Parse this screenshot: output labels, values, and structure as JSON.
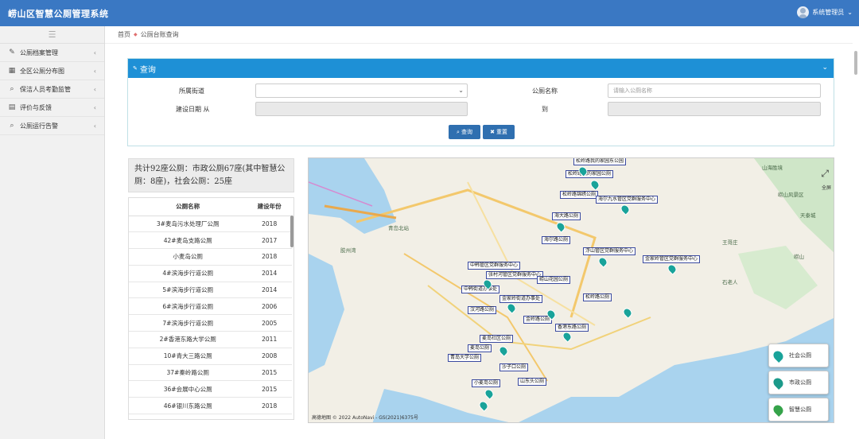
{
  "app": {
    "title": "崂山区智慧公厕管理系统",
    "user": "系统管理员"
  },
  "sidebar": {
    "items": [
      {
        "label": "公厕档案管理",
        "icon": "pencil-icon"
      },
      {
        "label": "全区公厕分布图",
        "icon": "map-icon"
      },
      {
        "label": "保洁人员考勤监管",
        "icon": "search-icon"
      },
      {
        "label": "评价与反馈",
        "icon": "list-icon"
      },
      {
        "label": "公厕运行告警",
        "icon": "search-icon"
      }
    ]
  },
  "breadcrumb": {
    "home": "首页",
    "current": "公厕台账查询"
  },
  "query": {
    "title": "查询",
    "street_label": "所属街道",
    "name_label": "公厕名称",
    "name_placeholder": "请输入公厕名称",
    "date_from_label": "建设日期 从",
    "date_to_label": "到",
    "search_button": "查询",
    "clear_button": "重置"
  },
  "stats": {
    "text": "共计92座公厕：市政公厕67座(其中智慧公厕：8座)，社会公厕：25座"
  },
  "table": {
    "headers": [
      "公厕名称",
      "建设年份"
    ],
    "rows": [
      [
        "3#麦岛污水处理厂公厕",
        "2018"
      ],
      [
        "42#麦岛支路公厕",
        "2017"
      ],
      [
        "小麦岛公厕",
        "2018"
      ],
      [
        "4#滨海步行道公厕",
        "2014"
      ],
      [
        "5#滨海步行道公厕",
        "2014"
      ],
      [
        "6#滨海步行道公厕",
        "2006"
      ],
      [
        "7#滨海步行道公厕",
        "2005"
      ],
      [
        "2#香港东路大学公厕",
        "2011"
      ],
      [
        "10#青大三路公厕",
        "2008"
      ],
      [
        "37#秦岭路公厕",
        "2015"
      ],
      [
        "36#会展中心公厕",
        "2015"
      ],
      [
        "46#银川东路公厕",
        "2018"
      ]
    ]
  },
  "map": {
    "labels": [
      "松岭路我的家园东公园",
      "松岭路我的家园公厕",
      "松岭路锦绣公厕",
      "海尔九水管区党群服务中心",
      "海尔路公厕",
      "松岭路公厕",
      "中韩管区党群服务中心",
      "金岭路公厕",
      "青岛大学公厕",
      "麦岛社区公厕",
      "金家岭街道办事处",
      "沙子口公厕",
      "山东头公厕",
      "小麦岛公厕",
      "海大路公厕",
      "崂山花园公厕",
      "汉河路公厕",
      "金家岭管区党群服务中心",
      "张村河管区党群服务中心",
      "香港东路公厕",
      "中韩街道办事处",
      "浮山管区党群服务中心",
      "麦岛公厕"
    ],
    "places": [
      "青岛北站",
      "胶州湾",
      "崂山风景区",
      "山海胜境",
      "石老人",
      "天泰城",
      "王哥庄",
      "崂山"
    ],
    "fullscreen_label": "全屏",
    "credit": "高德地图 © 2022 AutoNavi - GS(2021)6375号",
    "legend": [
      {
        "label": "社会公厕",
        "color": "#19a39a"
      },
      {
        "label": "市政公厕",
        "color": "#1b9a8a"
      },
      {
        "label": "智慧公厕",
        "color": "#35a34a"
      }
    ]
  }
}
